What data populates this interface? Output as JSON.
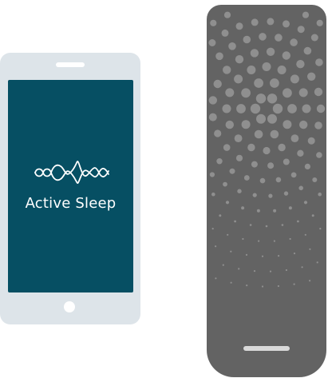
{
  "app": {
    "name": "Active Sleep",
    "logo_icon": "sound-wave-icon"
  },
  "colors": {
    "screen": "#064f63",
    "phone_body": "#dde4e9",
    "device_body": "#636363",
    "device_dots": "#8f8f8f"
  }
}
